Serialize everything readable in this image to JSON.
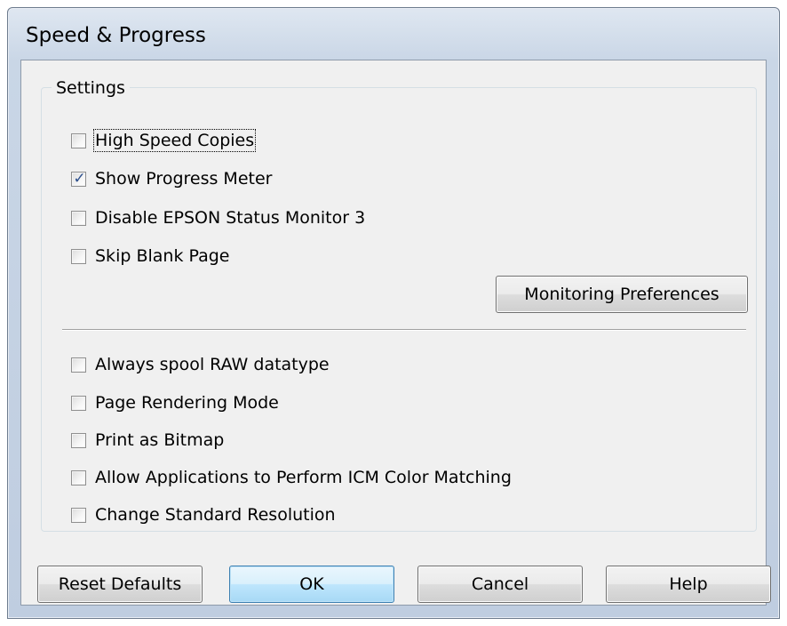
{
  "window": {
    "title": "Speed & Progress"
  },
  "settings_group": {
    "title": "Settings",
    "upper_options": [
      {
        "label": "High Speed Copies",
        "checked": false
      },
      {
        "label": "Show Progress Meter",
        "checked": true
      },
      {
        "label": "Disable EPSON Status Monitor 3",
        "checked": false
      },
      {
        "label": "Skip Blank Page",
        "checked": false
      }
    ],
    "monitoring_button_label": "Monitoring Preferences",
    "lower_options": [
      {
        "label": "Always spool RAW datatype",
        "checked": false
      },
      {
        "label": "Page Rendering Mode",
        "checked": false
      },
      {
        "label": "Print as Bitmap",
        "checked": false
      },
      {
        "label": "Allow Applications to Perform ICM Color Matching",
        "checked": false
      },
      {
        "label": "Change Standard Resolution",
        "checked": false
      }
    ]
  },
  "buttons": {
    "reset_label": "Reset Defaults",
    "ok_label": "OK",
    "cancel_label": "Cancel",
    "help_label": "Help"
  },
  "check_glyph": "✓",
  "colors": {
    "default_button_border": "#3c7fb1",
    "check_mark": "#2d4f8c"
  }
}
